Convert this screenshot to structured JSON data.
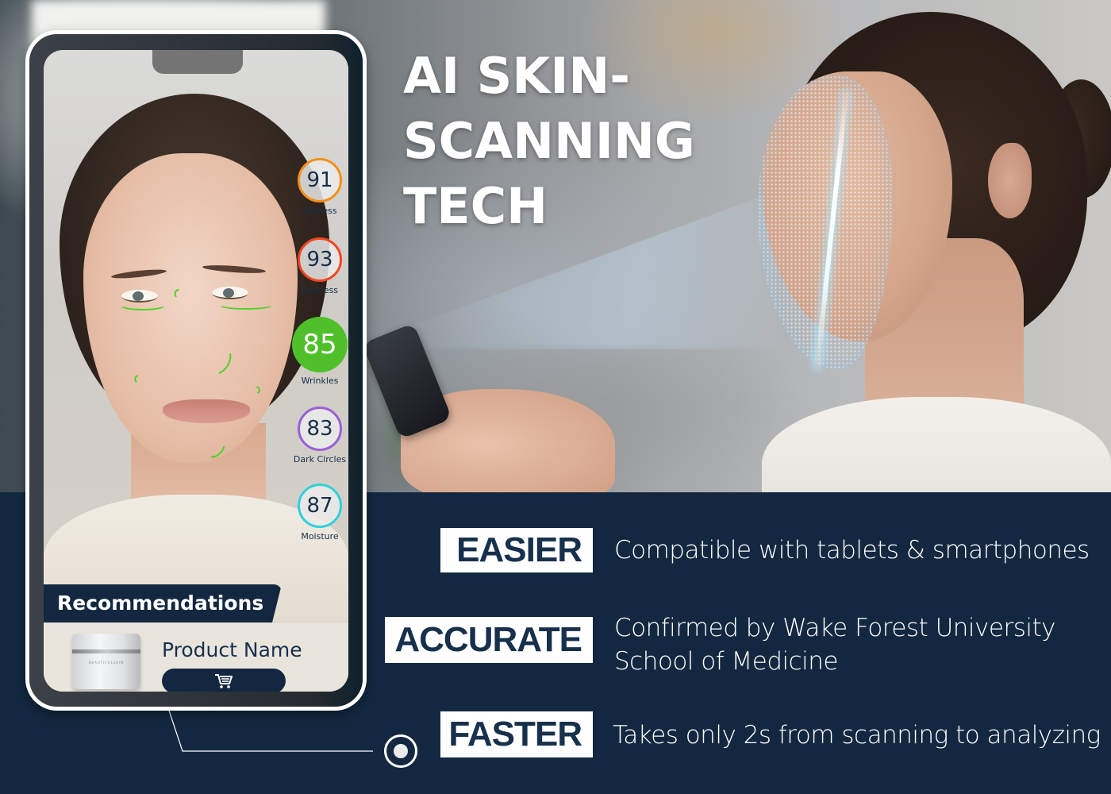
{
  "title": {
    "lines": [
      "AI SKIN-",
      "SCANNING",
      "TECH"
    ]
  },
  "phone": {
    "metrics": [
      {
        "value": "91",
        "label": "Oiliness",
        "color": "#f39019",
        "filled": false
      },
      {
        "value": "93",
        "label": "Redness",
        "color": "#f0461e",
        "filled": false
      },
      {
        "value": "85",
        "label": "Wrinkles",
        "color": "#4fc02a",
        "filled": true
      },
      {
        "value": "83",
        "label": "Dark Circles",
        "color": "#9b5fd6",
        "filled": false
      },
      {
        "value": "87",
        "label": "Moisture",
        "color": "#2fd0dc",
        "filled": false
      }
    ],
    "recommendations": {
      "heading": "Recommendations",
      "product_name": "Product Name",
      "jar_label": "BEAUTIFULSKIN",
      "cart_icon": "shopping-cart-icon"
    }
  },
  "features": [
    {
      "tag": "EASIER",
      "description": "Compatible with tablets & smartphones"
    },
    {
      "tag": "ACCURATE",
      "description": "Confirmed by Wake Forest University School of Medicine"
    },
    {
      "tag": "FASTER",
      "description": "Takes only 2s from scanning to analyzing"
    }
  ],
  "colors": {
    "navy": "#132840",
    "text_navy": "#17304c",
    "white": "#ffffff",
    "wrinkle_green": "#4fd02a"
  }
}
